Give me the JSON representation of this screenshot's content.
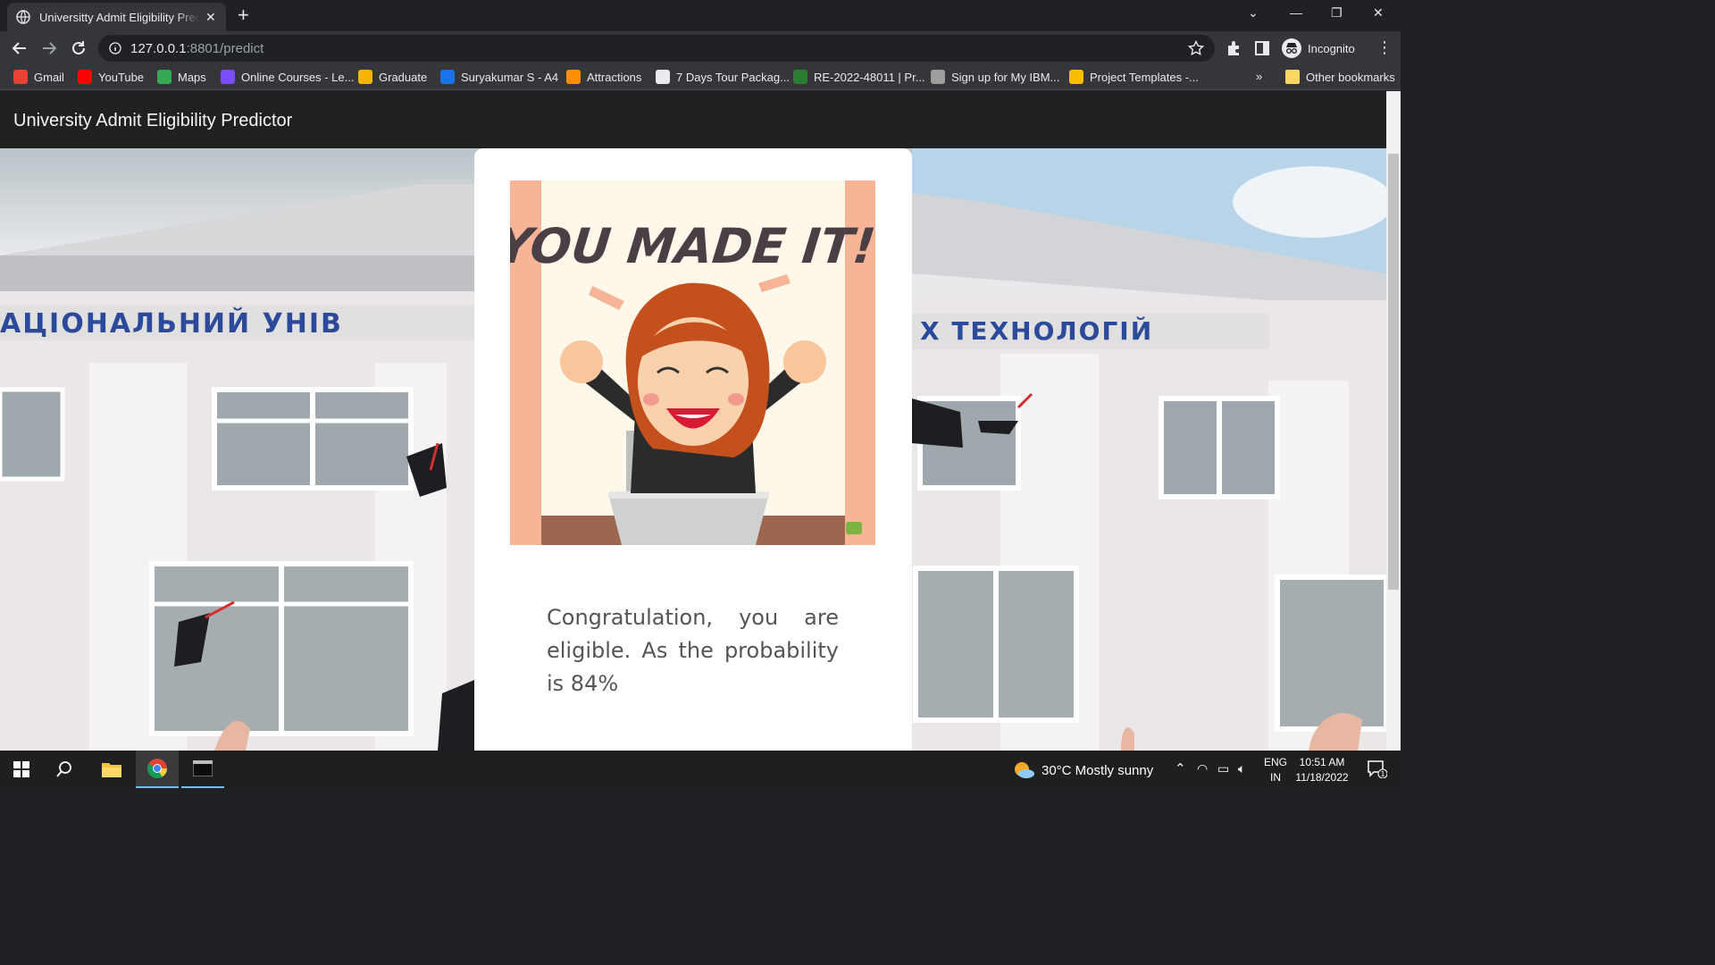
{
  "browser": {
    "tab_title": "Universitty Admit Eligibility Predictor",
    "url_host": "127.0.0.1",
    "url_path": ":8801/predict",
    "profile_label": "Incognito"
  },
  "bookmarks": [
    {
      "label": "Gmail",
      "icon": "gmail-icon",
      "color": "#ea4335"
    },
    {
      "label": "YouTube",
      "icon": "youtube-icon",
      "color": "#ff0000"
    },
    {
      "label": "Maps",
      "icon": "maps-icon",
      "color": "#34a853"
    },
    {
      "label": "Online Courses - Le...",
      "icon": "courses-icon",
      "color": "#7c4dff"
    },
    {
      "label": "Graduate",
      "icon": "graduate-icon",
      "color": "#f5b400"
    },
    {
      "label": "Suryakumar S - A4",
      "icon": "canva-icon",
      "color": "#1a73e8"
    },
    {
      "label": "Attractions",
      "icon": "attractions-icon",
      "color": "#ff8f00"
    },
    {
      "label": "7 Days Tour Packag...",
      "icon": "tour-icon",
      "color": "#e8eaed"
    },
    {
      "label": "RE-2022-48011 | Pr...",
      "icon": "re-icon",
      "color": "#2e7d32"
    },
    {
      "label": "Sign up for My IBM...",
      "icon": "ibm-icon",
      "color": "#9e9e9e"
    },
    {
      "label": "Project Templates -...",
      "icon": "drive-icon",
      "color": "#fbbc04"
    }
  ],
  "bookmarks_overflow": "»",
  "other_bookmarks": "Other bookmarks",
  "app": {
    "brand": "University Admit Eligibility Predictor",
    "illustration_text": "YOU MADE IT!",
    "result_message": "Congratulation, you are eligible. As the probability is 84%"
  },
  "taskbar": {
    "weather": "30°C  Mostly sunny",
    "language_top": "ENG",
    "language_bottom": "IN",
    "time": "10:51 AM",
    "date": "11/18/2022",
    "notification_count": "1"
  }
}
